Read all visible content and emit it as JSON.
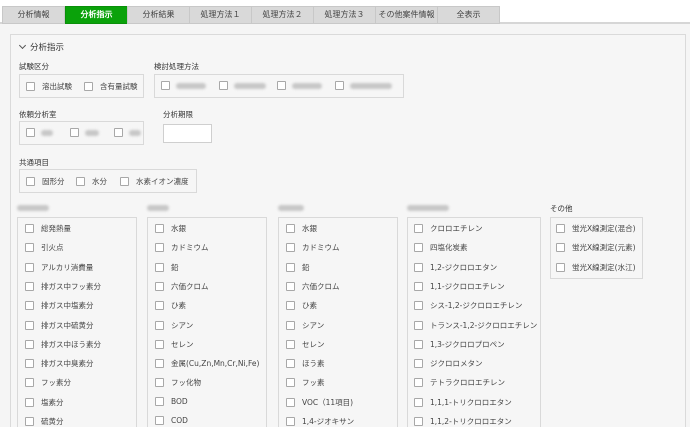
{
  "tabs": [
    {
      "label": "分析情報",
      "active": false
    },
    {
      "label": "分析指示",
      "active": true
    },
    {
      "label": "分析結果",
      "active": false
    },
    {
      "label": "処理方法１",
      "active": false
    },
    {
      "label": "処理方法２",
      "active": false
    },
    {
      "label": "処理方法３",
      "active": false
    },
    {
      "label": "その他案件情報",
      "active": false
    },
    {
      "label": "全表示",
      "active": false
    }
  ],
  "section": {
    "title": "分析指示"
  },
  "test_category": {
    "label": "試験区分",
    "options": [
      "溶出試験",
      "含有量試験"
    ]
  },
  "review_method": {
    "label": "検討処理方法"
  },
  "lab": {
    "label": "依頼分析室"
  },
  "deadline": {
    "label": "分析期限",
    "value": ""
  },
  "common": {
    "label": "共通項目",
    "options": [
      "固形分",
      "水分",
      "水素イオン濃度"
    ]
  },
  "col1": {
    "items": [
      "総発熱量",
      "引火点",
      "アルカリ消費量",
      "排ガス中フッ素分",
      "排ガス中塩素分",
      "排ガス中硫黄分",
      "排ガス中ほう素分",
      "排ガス中臭素分",
      "フッ素分",
      "塩素分",
      "硫黄分"
    ]
  },
  "col2": {
    "items": [
      "水銀",
      "カドミウム",
      "鉛",
      "六価クロム",
      "ひ素",
      "シアン",
      "セレン",
      "金属(Cu,Zn,Mn,Cr,Ni,Fe)",
      "フッ化物",
      "BOD",
      "COD"
    ]
  },
  "col3": {
    "items": [
      "水銀",
      "カドミウム",
      "鉛",
      "六価クロム",
      "ひ素",
      "シアン",
      "セレン",
      "ほう素",
      "フッ素",
      "VOC（11項目)",
      "1,4-ジオキサン"
    ]
  },
  "col4": {
    "items": [
      "クロロエチレン",
      "四塩化炭素",
      "1,2-ジクロロエタン",
      "1,1-ジクロロエチレン",
      "シス-1,2-ジクロロエチレン",
      "トランス-1,2-ジクロロエチレン",
      "1,3-ジクロロプロペン",
      "ジクロロメタン",
      "テトラクロロエチレン",
      "1,1,1-トリクロロエタン",
      "1,1,2-トリクロロエタン"
    ]
  },
  "col5": {
    "label": "その他",
    "items": [
      "蛍光X線測定(混合)",
      "蛍光X線測定(元素)",
      "蛍光X線測定(水江)"
    ]
  }
}
